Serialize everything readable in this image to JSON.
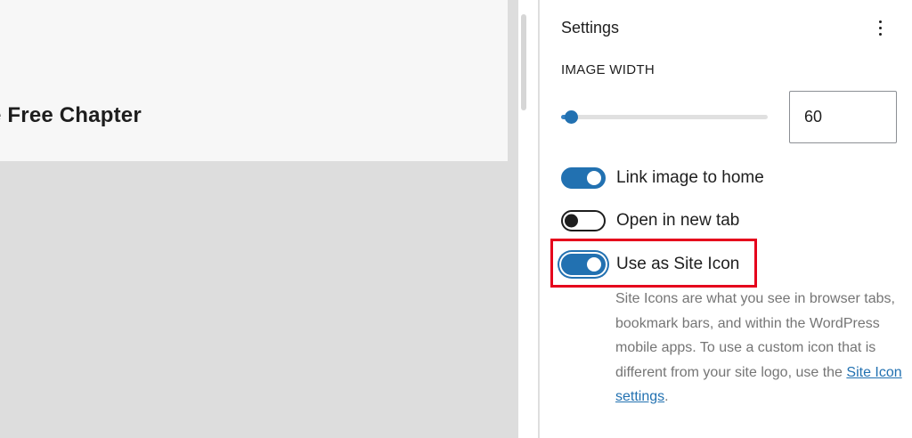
{
  "editor": {
    "heading_fragment": "e Free Chapter"
  },
  "sidebar": {
    "title": "Settings",
    "more_icon": "vertical-ellipsis-icon",
    "image_width": {
      "label": "IMAGE WIDTH",
      "value": "60",
      "slider_fraction": 0.05
    },
    "toggles": [
      {
        "label": "Link image to home",
        "checked": true
      },
      {
        "label": "Open in new tab",
        "checked": false
      },
      {
        "label": "Use as Site Icon",
        "checked": true
      }
    ],
    "help": {
      "text": "Site Icons are what you see in browser tabs, bookmark bars, and within the WordPress mobile apps. To use a custom icon that is different from your site logo, use the ",
      "link_label": "Site Icon settings",
      "suffix": "."
    }
  },
  "colors": {
    "accent": "#2271b1",
    "highlight": "#e5001c",
    "help_text": "#757575"
  }
}
